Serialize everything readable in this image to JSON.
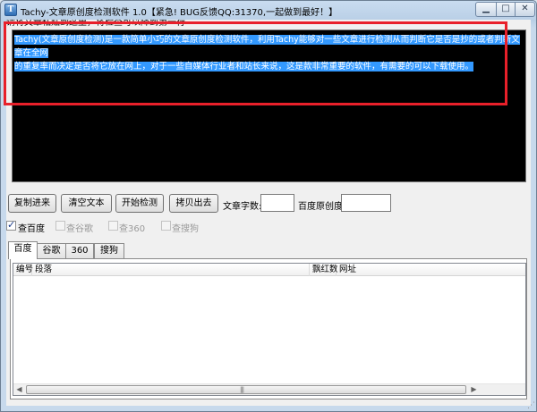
{
  "window": {
    "title": "Tachy-文章原创度检测软件 1.0【紧急! BUG反馈QQ:31370,一起做到最好！】",
    "minimize_glyph": "▁",
    "maximize_glyph": "□",
    "close_glyph": "✕",
    "app_icon_glyph": "T"
  },
  "input_area": {
    "hint": "请将文章粘贴到这里，将检查可以降到第一行",
    "text_line1": "Tachy(文章原创度检测)是一款简单小巧的文章原创度检测软件，利用Tachy能够对一些文章进行检测从而判断它是否是抄的或者判断文章在全网",
    "text_line2": "的重复率而决定是否将它放在网上，对于一些自媒体行业者和站长来说，这是款非常重要的软件，有需要的可以下载使用。"
  },
  "toolbar": {
    "copy_in": "复制进来",
    "clear": "清空文本",
    "start_check": "开始检测",
    "copy_out": "拷贝出去",
    "word_count_label": "文章字数:",
    "word_count_value": "",
    "baidu_originality_label": "百度原创度:",
    "baidu_originality_value": ""
  },
  "checkboxes": [
    {
      "label": "查百度",
      "checked": true,
      "enabled": true
    },
    {
      "label": "查谷歌",
      "checked": false,
      "enabled": false
    },
    {
      "label": "查360",
      "checked": false,
      "enabled": false
    },
    {
      "label": "查搜狗",
      "checked": false,
      "enabled": false
    }
  ],
  "tabs": [
    {
      "label": "百度",
      "active": true
    },
    {
      "label": "谷歌",
      "active": false
    },
    {
      "label": "360",
      "active": false
    },
    {
      "label": "搜狗",
      "active": false
    }
  ],
  "results_table": {
    "columns": [
      "编号",
      "段落",
      "飘红数",
      "网址"
    ],
    "rows": []
  },
  "scrollbar": {
    "left_arrow": "◀",
    "right_arrow": "▶",
    "grip": "|||"
  },
  "colors": {
    "selection": "#3399ff",
    "textbox_bg": "#000000",
    "highlight_border": "#e8202a"
  }
}
